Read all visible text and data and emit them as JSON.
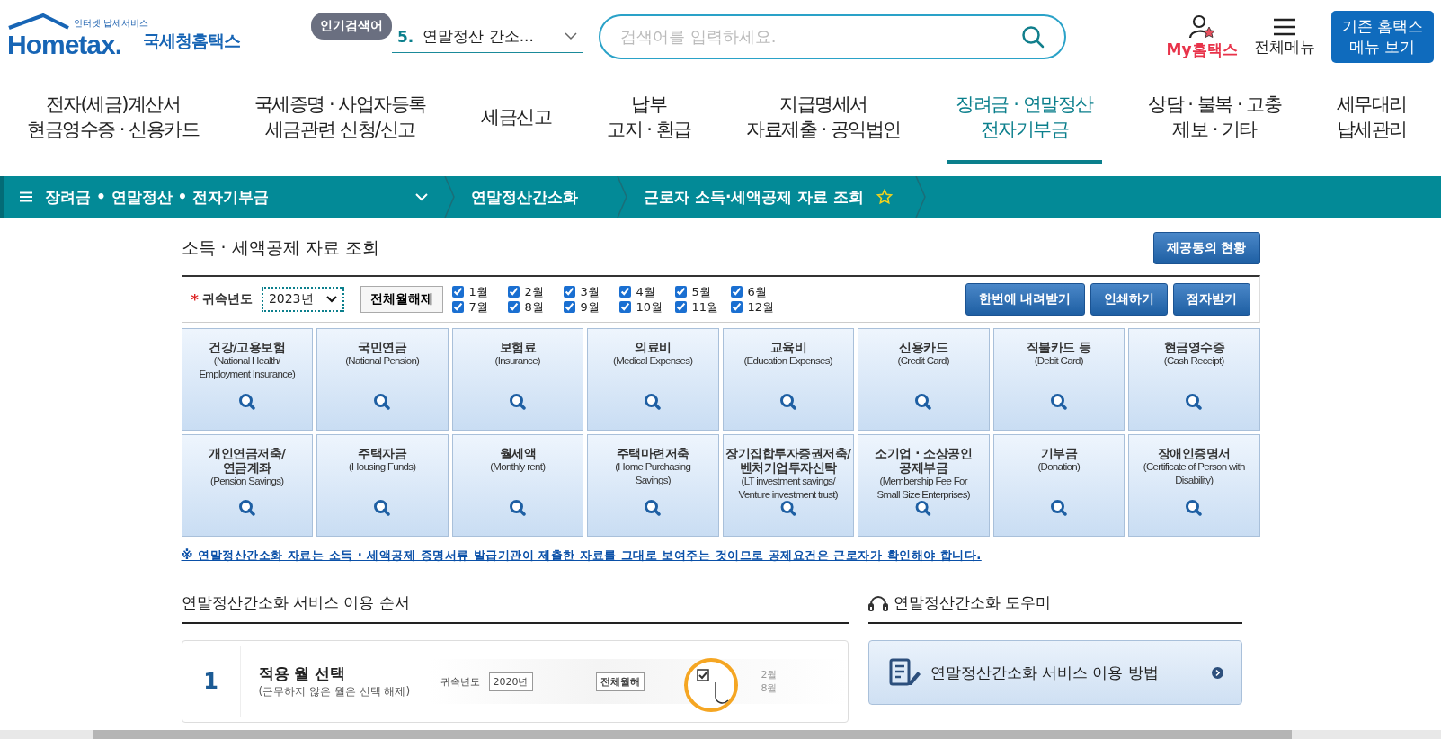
{
  "header": {
    "logo_tagline": "인터넷 납세서비스",
    "logo_word": "Hometax.",
    "logo_name": "국세청홈택스",
    "popular_badge": "인기검색어",
    "popular_rank": "5.",
    "popular_term": "연말정산 간소...",
    "search_placeholder": "검색어를 입력하세요.",
    "my_label": "My홈택스",
    "menu_label": "전체메뉴",
    "old_menu_lines": [
      "기존 홈택스",
      "메뉴 보기"
    ]
  },
  "nav": [
    {
      "lines": [
        "전자(세금)계산서",
        "현금영수증 · 신용카드"
      ],
      "selected": false
    },
    {
      "lines": [
        "국세증명 · 사업자등록",
        "세금관련 신청/신고"
      ],
      "selected": false
    },
    {
      "lines": [
        "세금신고"
      ],
      "selected": false
    },
    {
      "lines": [
        "납부",
        "고지 · 환급"
      ],
      "selected": false
    },
    {
      "lines": [
        "지급명세서",
        "자료제출 · 공익법인"
      ],
      "selected": false
    },
    {
      "lines": [
        "장려금 · 연말정산",
        "전자기부금"
      ],
      "selected": true
    },
    {
      "lines": [
        "상담 · 불복 · 고충",
        "제보 · 기타"
      ],
      "selected": false
    },
    {
      "lines": [
        "세무대리",
        "납세관리"
      ],
      "selected": false
    }
  ],
  "breadcrumb": [
    {
      "label": "장려금 • 연말정산 • 전자기부금",
      "kind": "menu"
    },
    {
      "label": "연말정산간소화",
      "kind": "link"
    },
    {
      "label": "근로자 소득·세액공제 자료 조회",
      "kind": "current"
    }
  ],
  "page_title": "소득 · 세액공제 자료 조회",
  "consent_button": "제공동의 현황",
  "filter": {
    "required_mark": "*",
    "year_label": "귀속년도",
    "year_value": "2023년",
    "clear_button": "전체월해제",
    "months": [
      {
        "label": "1월",
        "checked": true
      },
      {
        "label": "2월",
        "checked": true
      },
      {
        "label": "3월",
        "checked": true
      },
      {
        "label": "4월",
        "checked": true
      },
      {
        "label": "5월",
        "checked": true
      },
      {
        "label": "6월",
        "checked": true
      },
      {
        "label": "7월",
        "checked": true
      },
      {
        "label": "8월",
        "checked": true
      },
      {
        "label": "9월",
        "checked": true
      },
      {
        "label": "10월",
        "checked": true
      },
      {
        "label": "11월",
        "checked": true
      },
      {
        "label": "12월",
        "checked": true
      }
    ],
    "actions": [
      "한번에 내려받기",
      "인쇄하기",
      "점자받기"
    ]
  },
  "categories": [
    {
      "title": [
        "건강/고용보험"
      ],
      "subtitle": [
        "(National Health/",
        "Employment Insurance)"
      ]
    },
    {
      "title": [
        "국민연금"
      ],
      "subtitle": [
        "(National Pension)"
      ]
    },
    {
      "title": [
        "보험료"
      ],
      "subtitle": [
        "(Insurance)"
      ]
    },
    {
      "title": [
        "의료비"
      ],
      "subtitle": [
        "(Medical Expenses)"
      ]
    },
    {
      "title": [
        "교육비"
      ],
      "subtitle": [
        "(Education Expenses)"
      ]
    },
    {
      "title": [
        "신용카드"
      ],
      "subtitle": [
        "(Credit Card)"
      ]
    },
    {
      "title": [
        "직불카드 등"
      ],
      "subtitle": [
        "(Debit Card)"
      ]
    },
    {
      "title": [
        "현금영수증"
      ],
      "subtitle": [
        "(Cash Receipt)"
      ]
    },
    {
      "title": [
        "개인연금저축/",
        "연금계좌"
      ],
      "subtitle": [
        "(Pension Savings)"
      ]
    },
    {
      "title": [
        "주택자금"
      ],
      "subtitle": [
        "(Housing Funds)"
      ]
    },
    {
      "title": [
        "월세액"
      ],
      "subtitle": [
        "(Monthly rent)"
      ]
    },
    {
      "title": [
        "주택마련저축"
      ],
      "subtitle": [
        "(Home Purchasing",
        "Savings)"
      ]
    },
    {
      "title": [
        "장기집합투자증권저축/",
        "벤처기업투자신탁"
      ],
      "subtitle": [
        "(LT investment savings/",
        "Venture investment trust)"
      ]
    },
    {
      "title": [
        "소기업 · 소상공인",
        "공제부금"
      ],
      "subtitle": [
        "(Membership Fee For",
        "Small Size Enterprises)"
      ]
    },
    {
      "title": [
        "기부금"
      ],
      "subtitle": [
        "(Donation)"
      ]
    },
    {
      "title": [
        "장애인증명서"
      ],
      "subtitle": [
        "(Certificate of Person with",
        "Disability)"
      ]
    }
  ],
  "notice": "※ 연말정산간소화 자료는 소득 · 세액공제 증명서류 발급기관이 제출한 자료를 그대로 보여주는 것이므로 공제요건은 근로자가 확인해야 합니다.",
  "steps_title": "연말정산간소화 서비스 이용 순서",
  "steps": [
    {
      "number": "1",
      "title": "적용 월 선택",
      "note": "(근무하지 않은 월은 선택 해제)",
      "sample": {
        "year_label": "귀속년도",
        "year_value": "2020년",
        "clear_button": "전체월해",
        "months": [
          "2월",
          "8월"
        ]
      }
    }
  ],
  "helper_title": "연말정산간소화 도우미",
  "helper_items": [
    "연말정산간소화 서비스 이용 방법"
  ]
}
